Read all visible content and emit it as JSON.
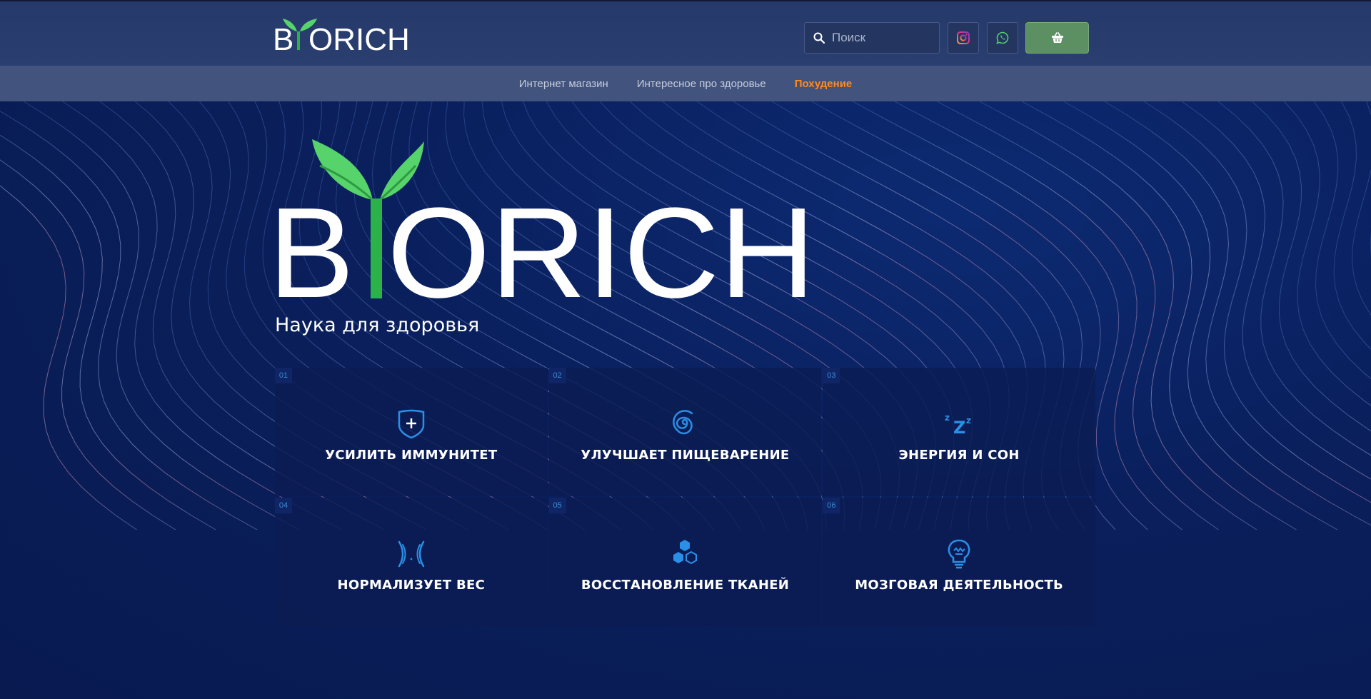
{
  "brand": {
    "logo_text": "BIORICH",
    "leaf_color": "#56d36a",
    "stem_color": "#2bb34a"
  },
  "header": {
    "search": {
      "placeholder": "Поиск",
      "value": ""
    },
    "cart_color": "#5c8f62"
  },
  "nav": {
    "items": [
      {
        "label": "Интернет магазин",
        "active": false
      },
      {
        "label": "Интересное про здоровье",
        "active": false
      },
      {
        "label": "Похудение",
        "active": true
      }
    ],
    "active_color": "#ff8a1e"
  },
  "hero": {
    "tagline": "Наука для здоровья"
  },
  "features": [
    {
      "num": "01",
      "title": "УСИЛИТЬ ИММУНИТЕТ",
      "icon": "shield-plus-icon"
    },
    {
      "num": "02",
      "title": "УЛУЧШАЕТ ПИЩЕВАРЕНИЕ",
      "icon": "spiral-icon"
    },
    {
      "num": "03",
      "title": "ЭНЕРГИЯ И СОН",
      "icon": "sleep-zzz-icon"
    },
    {
      "num": "04",
      "title": "НОРМАЛИЗУЕТ ВЕС",
      "icon": "waist-icon"
    },
    {
      "num": "05",
      "title": "ВОССТАНОВЛЕНИЕ ТКАНЕЙ",
      "icon": "hexagons-icon"
    },
    {
      "num": "06",
      "title": "МОЗГОВАЯ ДЕЯТЕЛЬНОСТЬ",
      "icon": "lightbulb-icon"
    }
  ],
  "accent_icon_color": "#2a8fe6"
}
